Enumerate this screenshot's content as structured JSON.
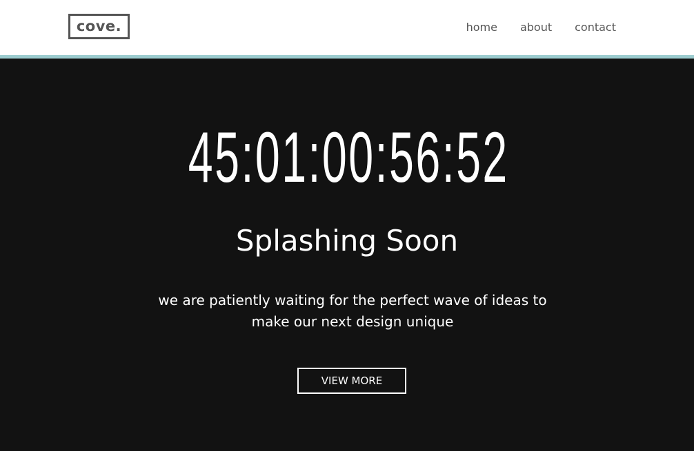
{
  "header": {
    "logo_text": "cove.",
    "nav": [
      {
        "label": "home"
      },
      {
        "label": "about"
      },
      {
        "label": "contact"
      }
    ]
  },
  "hero": {
    "countdown": "45:01:00:56:52",
    "title": "Splashing Soon",
    "tagline": "we are patiently waiting for the perfect wave of ideas to make our next design unique",
    "button_label": "VIEW MORE"
  },
  "colors": {
    "accent": "#9ccccf",
    "background": "#121212",
    "text_dark": "#555555"
  }
}
